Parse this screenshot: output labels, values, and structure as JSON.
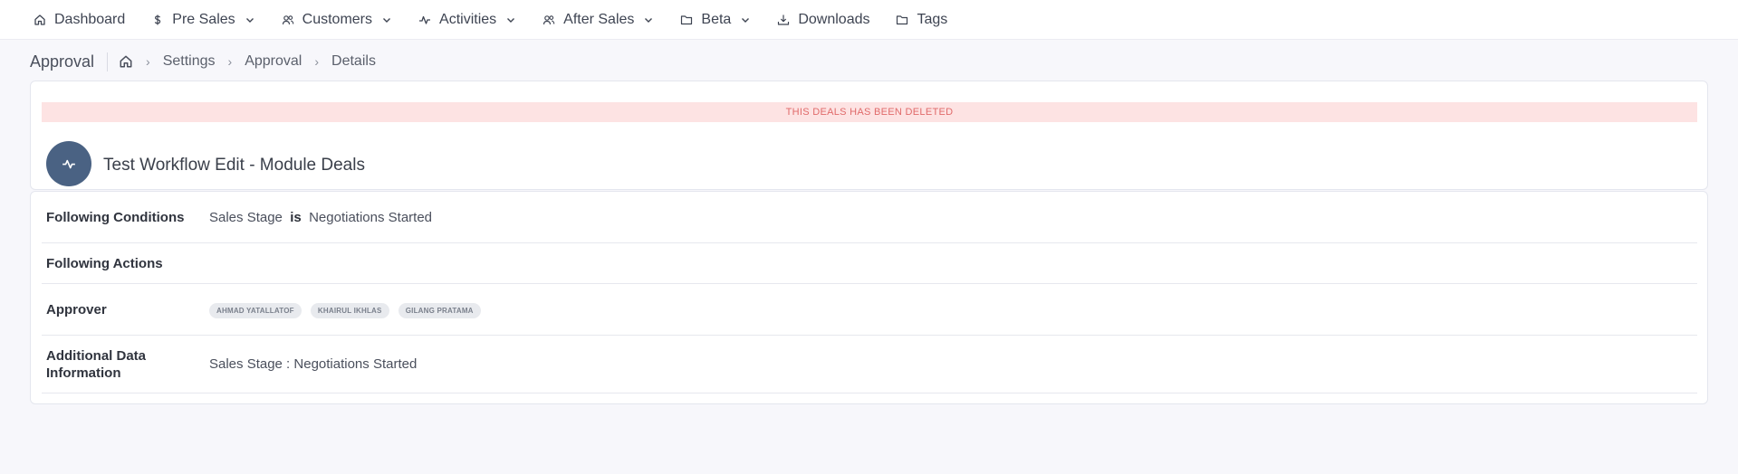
{
  "nav": {
    "items": [
      {
        "label": "Dashboard",
        "icon": "home-icon",
        "dropdown": false
      },
      {
        "label": "Pre Sales",
        "icon": "dollar-icon",
        "dropdown": true
      },
      {
        "label": "Customers",
        "icon": "users-icon",
        "dropdown": true
      },
      {
        "label": "Activities",
        "icon": "activity-icon",
        "dropdown": true
      },
      {
        "label": "After Sales",
        "icon": "users-icon",
        "dropdown": true
      },
      {
        "label": "Beta",
        "icon": "folder-icon",
        "dropdown": true
      },
      {
        "label": "Downloads",
        "icon": "download-icon",
        "dropdown": false
      },
      {
        "label": "Tags",
        "icon": "folder-icon",
        "dropdown": false
      }
    ]
  },
  "breadcrumb": {
    "title": "Approval",
    "home_icon": "home-icon",
    "items": [
      "Settings",
      "Approval",
      "Details"
    ]
  },
  "header_card": {
    "banner": "THIS DEALS HAS BEEN DELETED",
    "avatar_icon": "activity-icon",
    "title": "Test Workflow Edit - Module Deals"
  },
  "details": {
    "conditions": {
      "label": "Following Conditions",
      "field": "Sales Stage",
      "operator": "is",
      "value": "Negotiations Started"
    },
    "actions": {
      "label": "Following Actions"
    },
    "approver": {
      "label": "Approver",
      "names": [
        "AHMAD YATALLATOF",
        "KHAIRUL IKHLAS",
        "GILANG PRATAMA"
      ]
    },
    "additional": {
      "label_line1": "Additional Data",
      "label_line2": "Information",
      "value": "Sales Stage : Negotiations Started"
    }
  },
  "colors": {
    "banner_bg": "#fde3e3",
    "banner_text": "#e06a6a",
    "avatar_bg": "#4a6283"
  }
}
